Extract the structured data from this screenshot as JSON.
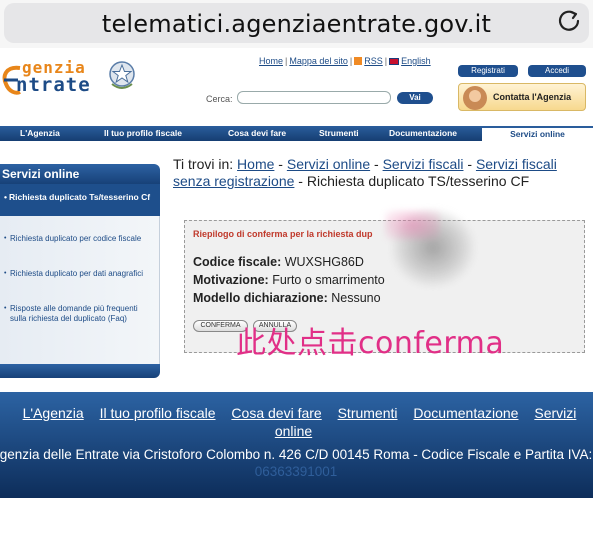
{
  "browser": {
    "url": "telematici.agenziaentrate.gov.it"
  },
  "header": {
    "logo_line1": "genzia",
    "logo_line2": "ntrate",
    "links": [
      "Home",
      "Mappa del sito",
      "RSS",
      "English"
    ],
    "register_label": "Registrati",
    "login_label": "Accedi",
    "search_label": "Cerca:",
    "search_value": "",
    "search_button": "Vai",
    "contact_label": "Contatta l'Agenzia"
  },
  "nav": {
    "items": [
      "L'Agenzia",
      "Il tuo profilo fiscale",
      "Cosa devi fare",
      "Strumenti",
      "Documentazione",
      "Servizi online"
    ],
    "active_index": 5
  },
  "sidebar": {
    "title": "Servizi online",
    "active_item": "Richiesta duplicato Ts/tesserino Cf",
    "items": [
      "Richiesta duplicato per codice fiscale",
      "Richiesta duplicato per dati anagrafici",
      "Risposte alle domande più frequenti sulla richiesta del duplicato (Faq)"
    ]
  },
  "breadcrumb": {
    "prefix": "Ti trovi in:",
    "links": [
      "Home",
      "Servizi online",
      "Servizi fiscali",
      "Servizi fiscali senza registrazione"
    ],
    "current": "Richiesta duplicato TS/tesserino CF"
  },
  "summary": {
    "title": "Riepilogo di conferma per la richiesta dup",
    "rows": [
      {
        "label": "Codice fiscale:",
        "value": "WUXSHG86D"
      },
      {
        "label": "Motivazione:",
        "value": "Furto o smarrimento"
      },
      {
        "label": "Modello dichiarazione:",
        "value": "Nessuno"
      }
    ],
    "confirm_label": "CONFERMA",
    "cancel_label": "ANNULLA"
  },
  "annotation": {
    "text": "此处点击conferma",
    "color": "#e12f87"
  },
  "footer": {
    "links": [
      "L'Agenzia",
      "Il tuo profilo fiscale",
      "Cosa devi fare",
      "Strumenti",
      "Documentazione",
      "Servizi online"
    ],
    "address": "genzia delle Entrate via Cristoforo Colombo n. 426 C/D 00145 Roma - Codice Fiscale e Partita IVA:",
    "piva": "06363391001"
  },
  "colors": {
    "brand_blue": "#1d4b86",
    "brand_orange": "#e8861a",
    "summary_title": "#c0392b"
  }
}
